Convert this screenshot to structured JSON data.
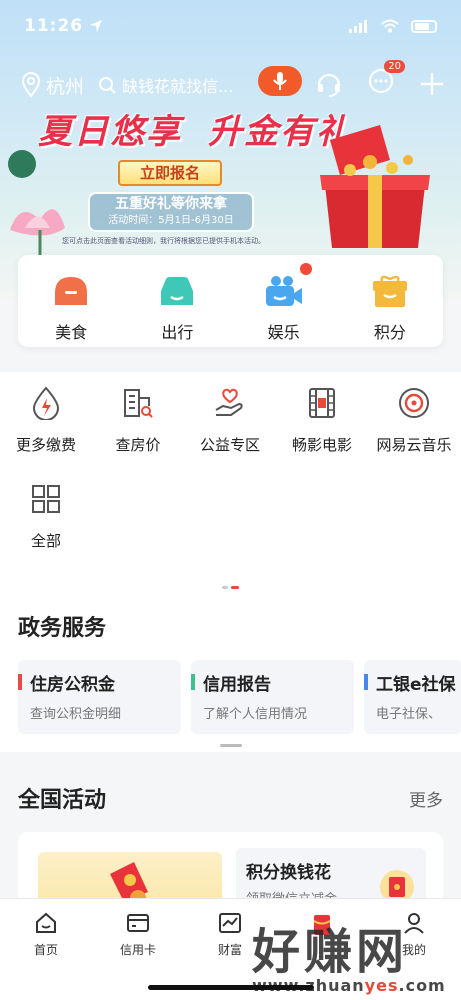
{
  "status_bar": {
    "time": "11:26"
  },
  "header": {
    "city": "杭州",
    "search_placeholder": "缺钱花就找信...",
    "message_badge": "20"
  },
  "banner": {
    "title_part1": "夏日悠享",
    "title_part2": "升金有礼",
    "signup_label": "立即报名",
    "subtitle": "五重好礼等你来拿",
    "period": "活动时间：5月1日-6月30日",
    "disclaimer": "您可点击此页面查看活动细则，我行将根据您已提供手机本活动。"
  },
  "categories": [
    {
      "label": "美食",
      "icon": "food-bag-icon",
      "color": "#f0704a"
    },
    {
      "label": "出行",
      "icon": "car-icon",
      "color": "#3fc7b8",
      "dot": true
    },
    {
      "label": "娱乐",
      "icon": "video-camera-icon",
      "color": "#4aa6ef"
    },
    {
      "label": "积分",
      "icon": "gift-icon",
      "color": "#f3b93a"
    }
  ],
  "services": [
    {
      "label": "更多缴费",
      "icon": "water-drop-bolt-icon"
    },
    {
      "label": "查房价",
      "icon": "building-search-icon"
    },
    {
      "label": "公益专区",
      "icon": "heart-hand-icon"
    },
    {
      "label": "畅影电影",
      "icon": "film-icon"
    },
    {
      "label": "网易云音乐",
      "icon": "music-disc-icon"
    },
    {
      "label": "全部",
      "icon": "grid-icon"
    }
  ],
  "gov": {
    "title": "政务服务",
    "cards": [
      {
        "title": "住房公积金",
        "subtitle": "查询公积金明细",
        "accent": "#e84a4a"
      },
      {
        "title": "信用报告",
        "subtitle": "了解个人信用情况",
        "accent": "#3fbf8a"
      },
      {
        "title": "工银e社保",
        "subtitle": "电子社保、",
        "accent": "#4a86e8"
      }
    ]
  },
  "activities": {
    "title": "全国活动",
    "more": "更多",
    "side_title": "积分换钱花",
    "side_subtitle": "领取微信立减金"
  },
  "tabbar": [
    {
      "label": "首页",
      "icon": "home-icon"
    },
    {
      "label": "信用卡",
      "icon": "credit-card-icon"
    },
    {
      "label": "财富",
      "icon": "chart-icon"
    },
    {
      "label": "",
      "icon": "gift-packet-icon"
    },
    {
      "label": "我的",
      "icon": "user-icon"
    }
  ],
  "watermark": {
    "big": "好赚网",
    "small_pre": "www.zhuan",
    "small_y": "yes",
    "small_post": ".com"
  }
}
